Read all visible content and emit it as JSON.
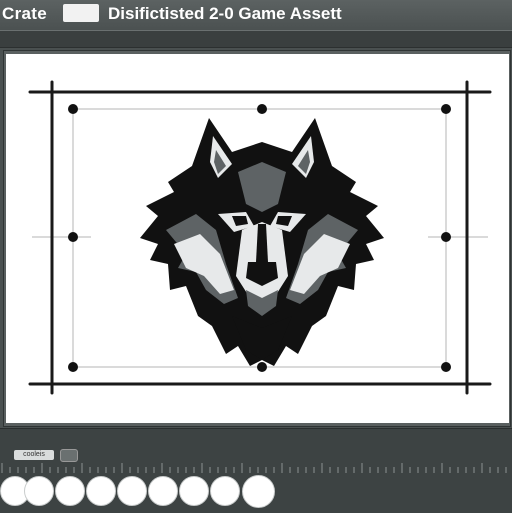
{
  "app": {
    "name": "Crate",
    "document_title": "Disifictisted 2-0 Game Assett"
  },
  "status": {
    "chip_label": "cooleis"
  },
  "colors": {
    "chrome": "#4a5050",
    "artboard": "#ffffff",
    "guide": "#1a1a1a",
    "wolf_dark": "#111111",
    "wolf_gray": "#5e6365",
    "wolf_light": "#e7e9ea"
  },
  "artwork": {
    "subject": "wolf-head-mascot"
  },
  "swatches": [
    {
      "name": "swatch-1",
      "color": "#ffffff"
    },
    {
      "name": "swatch-2",
      "color": "#ffffff"
    },
    {
      "name": "swatch-3",
      "color": "#ffffff"
    },
    {
      "name": "swatch-4",
      "color": "#ffffff"
    },
    {
      "name": "swatch-5",
      "color": "#ffffff"
    },
    {
      "name": "swatch-6",
      "color": "#ffffff"
    },
    {
      "name": "swatch-7",
      "color": "#ffffff"
    },
    {
      "name": "swatch-8",
      "color": "#ffffff"
    },
    {
      "name": "swatch-9",
      "color": "#ffffff"
    }
  ]
}
